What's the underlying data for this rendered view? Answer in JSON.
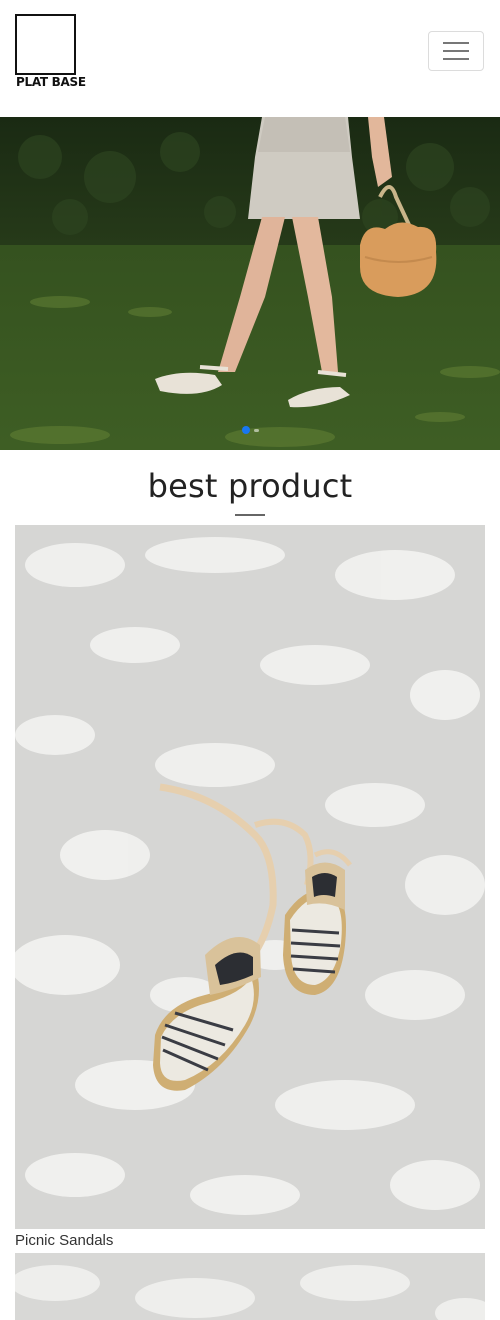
{
  "header": {
    "logo_text": "PLAT BASE",
    "menu_icon": "hamburger-menu-icon"
  },
  "hero": {
    "slides": 2,
    "active_slide": 1
  },
  "best_product": {
    "title": "best product",
    "items": [
      {
        "name": "Picnic Sandals"
      }
    ]
  },
  "colors": {
    "indicator_active": "#1877f2",
    "title_text": "#222222",
    "grass": "#3d5a22",
    "hedge": "#1f3117"
  }
}
